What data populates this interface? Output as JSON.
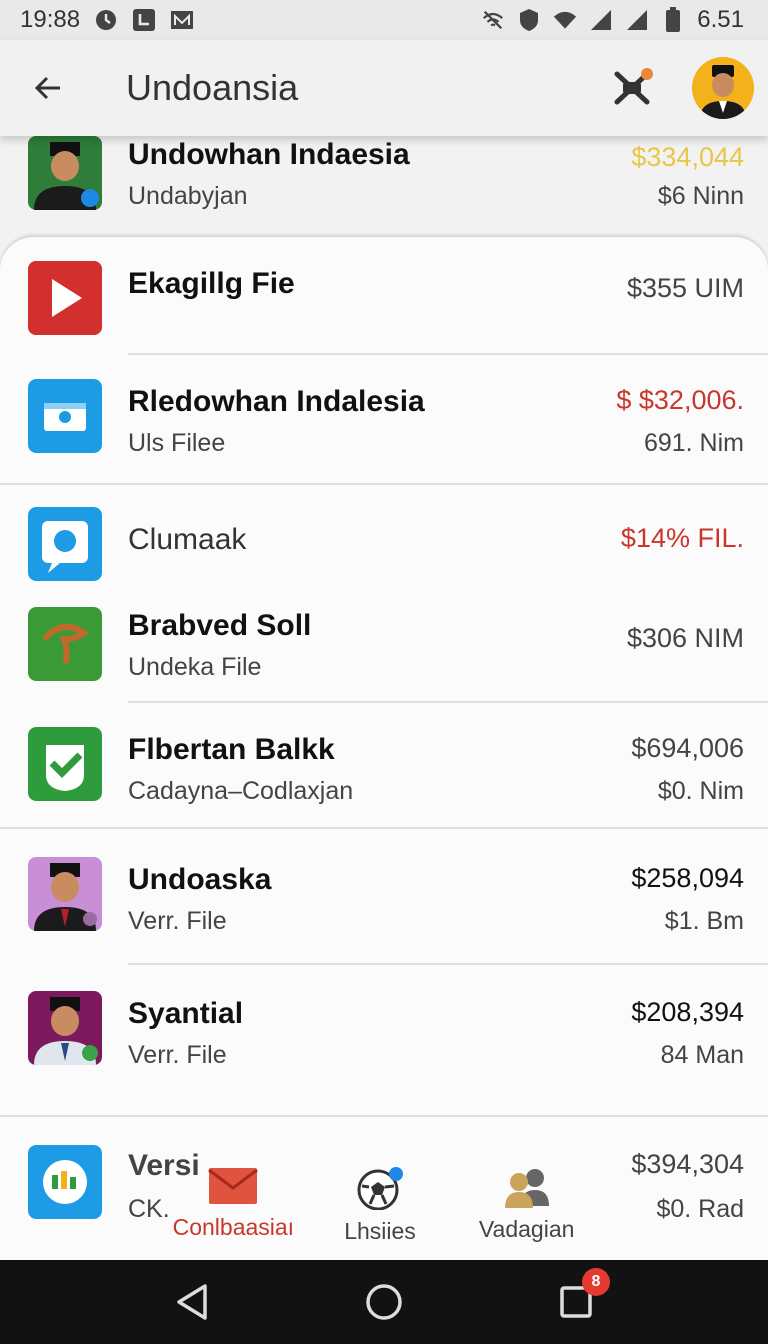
{
  "status_bar": {
    "time": "19:88",
    "battery_time": "6.51",
    "left_icons": [
      "sync-icon",
      "download-icon",
      "gmail-icon"
    ],
    "right_icons": [
      "no-network-icon",
      "shield-icon",
      "wifi-icon",
      "signal-icon",
      "signal-icon",
      "battery-icon"
    ]
  },
  "app_bar": {
    "title": "Undoansia",
    "back_icon": "arrow-left-icon",
    "action_icon": "crossed-tools-icon"
  },
  "top_row": {
    "name": "Undowhan Indaesia",
    "sub": "Undabyjan",
    "amount": "$334,044",
    "amount_sub": "$6 Ninn"
  },
  "rows": [
    {
      "name": "Ekagillg Fie",
      "sub": "",
      "amount": "$355 UIM",
      "amount_sub": "",
      "icon": "video-play-icon",
      "amount_color": "#444444"
    },
    {
      "name": "Rledowhan Indalesia",
      "sub": "Uls Filee",
      "amount": "$ $32,006.",
      "amount_sub": "691. Nim",
      "icon": "wallet-icon",
      "amount_color": "#c9372c"
    },
    {
      "name": "Clumaak",
      "sub": "",
      "amount": "$14% FIL.",
      "amount_sub": "",
      "icon": "chat-bubble-icon",
      "amount_color": "#c9372c"
    },
    {
      "name": "Brabved Soll",
      "sub": "Undeka File",
      "amount": "$306 NIM",
      "amount_sub": "",
      "icon": "leaf-icon",
      "amount_color": "#444444"
    },
    {
      "name": "Flbertan Balkk",
      "sub": "Cadayna–Codlaxjan",
      "amount": "$694,006",
      "amount_sub": "$0. Nim",
      "icon": "checkmark-icon",
      "amount_color": "#444444"
    },
    {
      "name": "Undoaska",
      "sub": "Verr. File",
      "amount": "$258,094",
      "amount_sub": "$1. Bm",
      "icon": "person-photo-icon",
      "amount_color": "#111111"
    },
    {
      "name": "Syantial",
      "sub": "Verr. File",
      "amount": "$208,394",
      "amount_sub": "84 Man",
      "icon": "person-photo-icon",
      "amount_color": "#111111"
    },
    {
      "name": "Versi",
      "sub": "CK.",
      "amount": "$394,304",
      "amount_sub": "$0. Rad",
      "icon": "chart-app-icon",
      "amount_color": "#444444"
    }
  ],
  "bottom_nav": [
    {
      "label": "Conlbaasiaı",
      "icon": "mail-icon",
      "active": true
    },
    {
      "label": "Lhsiies",
      "icon": "soccer-ball-icon",
      "active": false
    },
    {
      "label": "Vadagian",
      "icon": "people-icon",
      "active": false
    }
  ],
  "system_nav": {
    "recents_badge": "8"
  }
}
